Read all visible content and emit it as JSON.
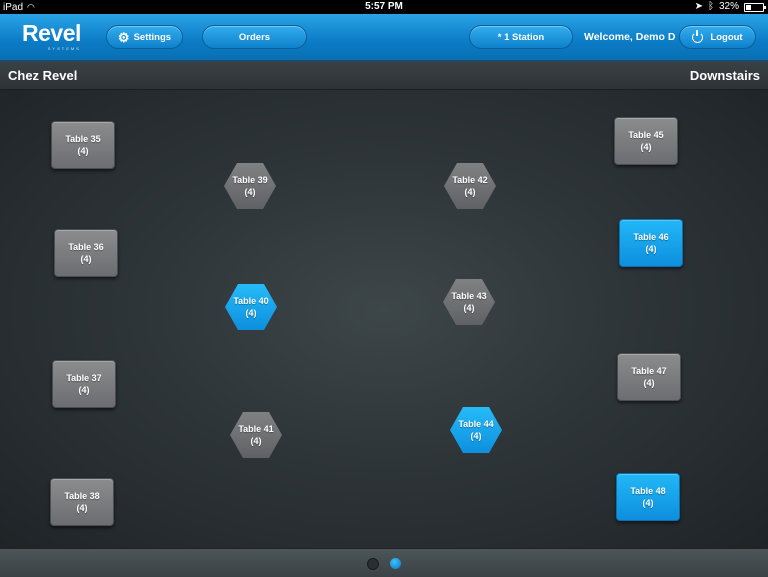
{
  "status_bar": {
    "device": "iPad",
    "time": "5:57 PM",
    "battery": "32%",
    "battery_level": 0.32,
    "icons": [
      "wifi-icon",
      "location-icon",
      "bluetooth-icon",
      "battery-icon"
    ]
  },
  "header": {
    "logo": "Revel",
    "logo_sub": "SYSTEMS",
    "settings_label": "Settings",
    "orders_label": "Orders",
    "station_label": "* 1 Station",
    "welcome": "Welcome, Demo D",
    "logout_label": "Logout"
  },
  "subheader": {
    "restaurant": "Chez Revel",
    "area": "Downstairs"
  },
  "tables": [
    {
      "name": "Table 35",
      "seats": "(4)",
      "shape": "square",
      "active": false
    },
    {
      "name": "Table 36",
      "seats": "(4)",
      "shape": "square",
      "active": false
    },
    {
      "name": "Table 37",
      "seats": "(4)",
      "shape": "square",
      "active": false
    },
    {
      "name": "Table 38",
      "seats": "(4)",
      "shape": "square",
      "active": false
    },
    {
      "name": "Table 39",
      "seats": "(4)",
      "shape": "hex",
      "active": false
    },
    {
      "name": "Table 40",
      "seats": "(4)",
      "shape": "hex",
      "active": true
    },
    {
      "name": "Table 41",
      "seats": "(4)",
      "shape": "hex",
      "active": false
    },
    {
      "name": "Table 42",
      "seats": "(4)",
      "shape": "hex",
      "active": false
    },
    {
      "name": "Table 43",
      "seats": "(4)",
      "shape": "hex",
      "active": false
    },
    {
      "name": "Table 44",
      "seats": "(4)",
      "shape": "hex",
      "active": true
    },
    {
      "name": "Table 45",
      "seats": "(4)",
      "shape": "square",
      "active": false
    },
    {
      "name": "Table 46",
      "seats": "(4)",
      "shape": "square",
      "active": true
    },
    {
      "name": "Table 47",
      "seats": "(4)",
      "shape": "square",
      "active": false
    },
    {
      "name": "Table 48",
      "seats": "(4)",
      "shape": "square",
      "active": true
    }
  ],
  "pager": {
    "pages": 2,
    "current": 2
  },
  "colors": {
    "accent": "#0d8fde",
    "header": "#0b7cc6",
    "table_idle": "#6b6d70"
  }
}
